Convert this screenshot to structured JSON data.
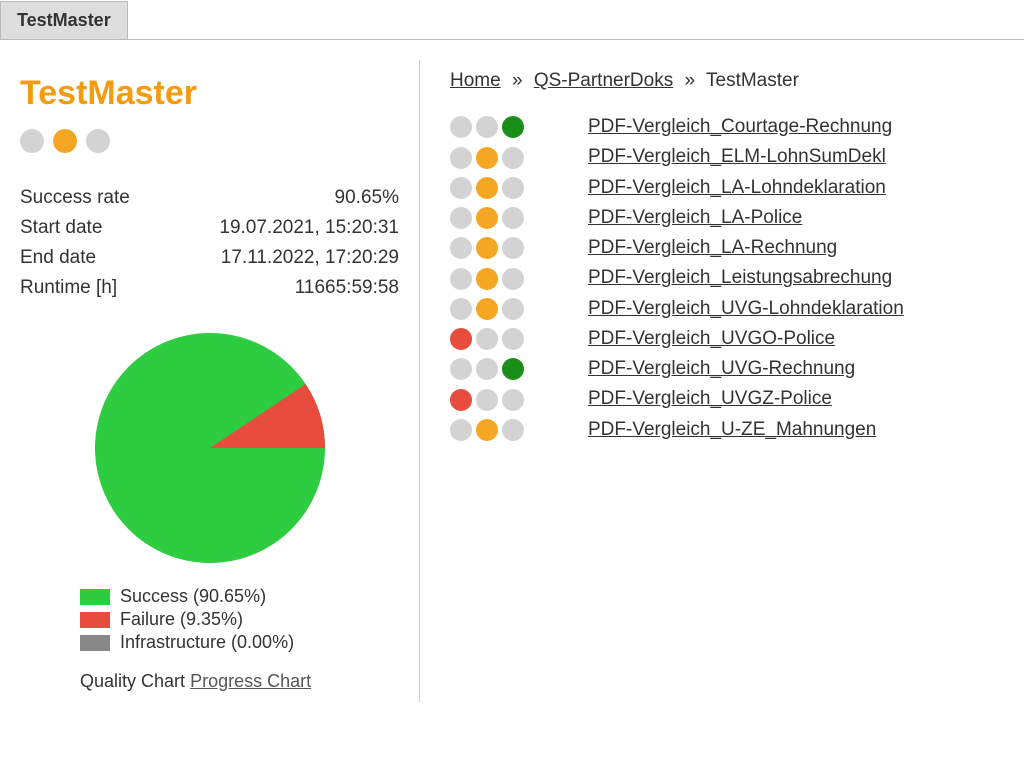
{
  "tab": {
    "label": "TestMaster"
  },
  "left": {
    "title": "TestMaster",
    "status_dots": [
      "grey",
      "orange",
      "grey"
    ],
    "stats": {
      "success_rate_label": "Success rate",
      "success_rate_value": "90.65%",
      "start_date_label": "Start date",
      "start_date_value": "19.07.2021, 15:20:31",
      "end_date_label": "End date",
      "end_date_value": "17.11.2022, 17:20:29",
      "runtime_label": "Runtime [h]",
      "runtime_value": "11665:59:58"
    },
    "legend": {
      "success": "Success (90.65%)",
      "failure": "Failure (9.35%)",
      "infrastructure": "Infrastructure (0.00%)"
    },
    "chart_links": {
      "quality": "Quality Chart",
      "progress": "Progress Chart"
    }
  },
  "breadcrumb": {
    "home": "Home",
    "mid": "QS-PartnerDoks",
    "current": "TestMaster",
    "sep": "»"
  },
  "items": [
    {
      "dots": [
        "grey",
        "grey",
        "dark-green"
      ],
      "label": "PDF-Vergleich_Courtage-Rechnung"
    },
    {
      "dots": [
        "grey",
        "orange",
        "grey"
      ],
      "label": "PDF-Vergleich_ELM-LohnSumDekl"
    },
    {
      "dots": [
        "grey",
        "orange",
        "grey"
      ],
      "label": "PDF-Vergleich_LA-Lohndeklaration"
    },
    {
      "dots": [
        "grey",
        "orange",
        "grey"
      ],
      "label": "PDF-Vergleich_LA-Police"
    },
    {
      "dots": [
        "grey",
        "orange",
        "grey"
      ],
      "label": "PDF-Vergleich_LA-Rechnung"
    },
    {
      "dots": [
        "grey",
        "orange",
        "grey"
      ],
      "label": "PDF-Vergleich_Leistungsabrechung"
    },
    {
      "dots": [
        "grey",
        "orange",
        "grey"
      ],
      "label": "PDF-Vergleich_UVG-Lohndeklaration"
    },
    {
      "dots": [
        "red",
        "grey",
        "grey"
      ],
      "label": "PDF-Vergleich_UVGO-Police"
    },
    {
      "dots": [
        "grey",
        "grey",
        "dark-green"
      ],
      "label": "PDF-Vergleich_UVG-Rechnung"
    },
    {
      "dots": [
        "red",
        "grey",
        "grey"
      ],
      "label": "PDF-Vergleich_UVGZ-Police"
    },
    {
      "dots": [
        "grey",
        "orange",
        "grey"
      ],
      "label": "PDF-Vergleich_U-ZE_Mahnungen"
    }
  ],
  "chart_data": {
    "type": "pie",
    "title": "Quality Chart",
    "series": [
      {
        "name": "Success",
        "value": 90.65,
        "color": "#2ecc40"
      },
      {
        "name": "Failure",
        "value": 9.35,
        "color": "#e74c3c"
      },
      {
        "name": "Infrastructure",
        "value": 0.0,
        "color": "#888888"
      }
    ]
  }
}
